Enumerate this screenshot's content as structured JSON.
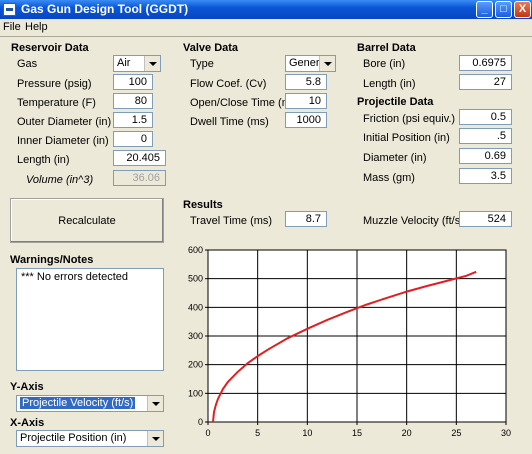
{
  "window": {
    "title": "Gas Gun Design Tool (GGDT)",
    "min": "_",
    "max": "□",
    "close": "X"
  },
  "menu": [
    "File",
    "Help"
  ],
  "reservoir": {
    "header": "Reservoir Data",
    "gas_label": "Gas",
    "gas_value": "Air",
    "pressure_label": "Pressure (psig)",
    "pressure": "100",
    "temperature_label": "Temperature (F)",
    "temperature": "80",
    "outer_label": "Outer Diameter (in)",
    "outer": "1.5",
    "inner_label": "Inner Diameter (in)",
    "inner": "0",
    "length_label": "Length (in)",
    "length": "20.405",
    "volume_label": "Volume (in^3)",
    "volume": "36.06"
  },
  "valve": {
    "header": "Valve Data",
    "type_label": "Type",
    "type_value": "Generic",
    "flow_label": "Flow Coef. (Cv)",
    "flow": "5.8",
    "openclose_label": "Open/Close Time (ms)",
    "openclose": "10",
    "dwell_label": "Dwell Time (ms)",
    "dwell": "1000"
  },
  "barrel": {
    "header": "Barrel Data",
    "bore_label": "Bore (in)",
    "bore": "0.6975",
    "length_label": "Length (in)",
    "length": "27"
  },
  "projectile": {
    "header": "Projectile Data",
    "friction_label": "Friction (psi equiv.)",
    "friction": "0.5",
    "initpos_label": "Initial Position (in)",
    "initpos": ".5",
    "diameter_label": "Diameter (in)",
    "diameter": "0.69",
    "mass_label": "Mass (gm)",
    "mass": "3.5"
  },
  "recalculate": "Recalculate",
  "results": {
    "header": "Results",
    "travel_label": "Travel Time (ms)",
    "travel": "8.7",
    "muzzle_label": "Muzzle Velocity (ft/s)",
    "muzzle": "524"
  },
  "warnings": {
    "header": "Warnings/Notes",
    "text": "*** No errors detected"
  },
  "yaxis": {
    "header": "Y-Axis",
    "value": "Projectile Velocity (ft/s)"
  },
  "xaxis": {
    "header": "X-Axis",
    "value": "Projectile Position (in)"
  },
  "chart_data": {
    "type": "line",
    "xlim": [
      0,
      30
    ],
    "ylim": [
      0,
      600
    ],
    "xticks": [
      0,
      5,
      10,
      15,
      20,
      25,
      30
    ],
    "yticks": [
      0,
      100,
      200,
      300,
      400,
      500,
      600
    ],
    "grid": true,
    "line_color": "#e02020",
    "series": [
      {
        "x": [
          0.5,
          0.6,
          0.8,
          1,
          1.5,
          2,
          3,
          4,
          5,
          6,
          8,
          10,
          12,
          14,
          16,
          18,
          20,
          22,
          24,
          26,
          27
        ],
        "y": [
          0,
          35,
          60,
          80,
          115,
          140,
          175,
          205,
          230,
          252,
          292,
          325,
          356,
          384,
          410,
          433,
          455,
          474,
          492,
          510,
          524
        ]
      }
    ]
  }
}
